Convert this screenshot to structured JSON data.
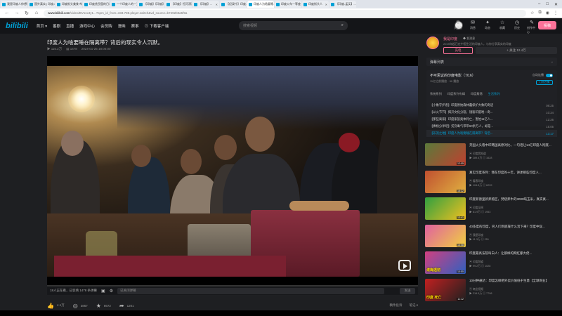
{
  "browser": {
    "tabs": [
      {
        "label": "我是印度人你想知道什么",
        "active": false
      },
      {
        "label": "国外真实 | 印度人...",
        "active": false
      },
      {
        "label": "印度街头美食 哔哩",
        "active": false
      },
      {
        "label": "印度贫民窟的日常",
        "active": false
      },
      {
        "label": "一个印度人的一天...",
        "active": false
      },
      {
        "label": "【印度】【印度】...",
        "active": false
      },
      {
        "label": "【印度】恒河漂流",
        "active": false
      },
      {
        "label": "【印度】...",
        "active": false
      },
      {
        "label": "【纪录片】印度...",
        "active": false
      },
      {
        "label": "印度人为啥要睡...",
        "active": true
      },
      {
        "label": "印度火车一等座",
        "active": false
      },
      {
        "label": "印度街头人",
        "active": false
      },
      {
        "label": "【印度-孟买】...",
        "active": false
      }
    ],
    "url_host": "www.bilibili.com",
    "url_path": "/video/BV1xx4y1...?spm_id_from=333.788.player.switch&vd_source=b7492b9a5f9a"
  },
  "header": {
    "logo": "bilibili",
    "nav": [
      "首页 ▾",
      "番剧",
      "直播",
      "游戏中心",
      "会员购",
      "漫画",
      "赛事",
      "⊙ 下载客户端"
    ],
    "search_placeholder": "搜索视频",
    "right_items": [
      {
        "icon": "crown-icon",
        "label": "大会员"
      },
      {
        "icon": "message-icon",
        "label": "消息"
      },
      {
        "icon": "dynamic-icon",
        "label": "动态"
      },
      {
        "icon": "star-icon",
        "label": "收藏"
      },
      {
        "icon": "history-icon",
        "label": "历史"
      },
      {
        "icon": "bulb-icon",
        "label": "创作中心"
      }
    ],
    "upload_label": "投稿"
  },
  "video": {
    "title": "印度人为啥要睡在隔离带？背后的现实令人沉默。",
    "meta": [
      "▶ 115.2万",
      "▤ 1478",
      "2024-01-25 18:00:00"
    ],
    "progress": 0.0
  },
  "danmaku": {
    "count_text": "18人正在看，已装填 1478 条弹幕",
    "placeholder": "已关闭弹幕",
    "send_label": "发送"
  },
  "toolbar": {
    "like": "4.1万",
    "coin": "3867",
    "collect": "8672",
    "share": "1201",
    "right": [
      "稿件投诉",
      "笔记 ▾"
    ]
  },
  "up": {
    "name": "我是印度",
    "badge": "◆ 发消息",
    "desc": "2019年起已在中国生活的印度人，与你分享真实的印度",
    "charge_label": "充电",
    "follow_label": "+ 关注 12.4万"
  },
  "sidebar": {
    "danmaku_list_label": "弹幕列表",
    "playlist_title": "不可思议的印度电影（7/16）",
    "playlist_sub": "11亿之前播放 · 90 播放",
    "autoplay_label": "自动连播",
    "playlist_btn": "订阅合集",
    "playlist_tabs": [
      {
        "label": "系统系列",
        "on": false
      },
      {
        "label": "印度系列专辑",
        "on": false
      },
      {
        "label": "印度集锦",
        "on": false
      },
      {
        "label": "生活系列",
        "on": true
      }
    ],
    "episodes": [
      {
        "title": "【小象守护者】印度原始森林蠢保护大象的奇迹",
        "dur": "08:25",
        "cur": false
      },
      {
        "title": "【以火节节】揭开文化分裂，镜彼印度唯一奇...",
        "dur": "10:34",
        "cur": false
      },
      {
        "title": "【那些离家】印度家族奥体死亡，害怕11亿人...",
        "dur": "12:26",
        "cur": false
      },
      {
        "title": "【捧杨分享吧】贫穷毒气带带60余万人，却是...",
        "dur": "15:05",
        "cur": false
      },
      {
        "title": "【非流之地】印度人为啥要睡在隔离带？背后...",
        "dur": "13:17",
        "cur": true
      }
    ],
    "recommend": [
      {
        "title": "英国火头看中印两国高原对比，一句话让14亿印度人彻底...",
        "up": "▣ 印度我知道",
        "stats": "▶ 289.4万  ▤ 1628",
        "thumb_text": "",
        "dur": "12:05",
        "colors": [
          "#5a7a3a",
          "#c04030"
        ]
      },
      {
        "title": "真实印度系列：我在印度的十年，讲述那些印度人...",
        "up": "▣ 看客印度",
        "stats": "▶ 104.8万  ▤ 6299",
        "thumb_text": "",
        "dur": "16:22",
        "colors": [
          "#c05030",
          "#e0b040"
        ]
      },
      {
        "title": "印度新德里新养殖区，焚烧养牛的3000吨玉米，真实真...",
        "up": "▣ 印度见闻",
        "stats": "▶ 81.9万  ▤ 1953",
        "thumb_text": "",
        "dur": "13:41",
        "colors": [
          "#30a040",
          "#f0c020"
        ]
      },
      {
        "title": "40多度的印度，穷人们到底靠什么活下来？印度中穿...",
        "up": "▣ 我是印度",
        "stats": "▶ 11.3万  ▤ 251",
        "thumb_text": "",
        "dur": "14:08",
        "colors": [
          "#e060a0",
          "#f0d040"
        ]
      },
      {
        "title": "印度最高法院叫白人：让那样的网红都大佬...",
        "up": "▣ 印度频道",
        "stats": "▶ 99.2万  ▤ 1028",
        "thumb_text": "滚梅透彻",
        "dur": "10:55",
        "colors": [
          "#d04080",
          "#3060c0"
        ]
      },
      {
        "title": "10分钟通达：印度怎样把外卖价值低于生意【全球商业】",
        "up": "▣ 商业视频",
        "stats": "▶ 216.5万  ▤ 7798",
        "thumb_text": "印度 死亡",
        "dur": "11:12",
        "colors": [
          "#c02020",
          "#202020"
        ]
      }
    ]
  }
}
